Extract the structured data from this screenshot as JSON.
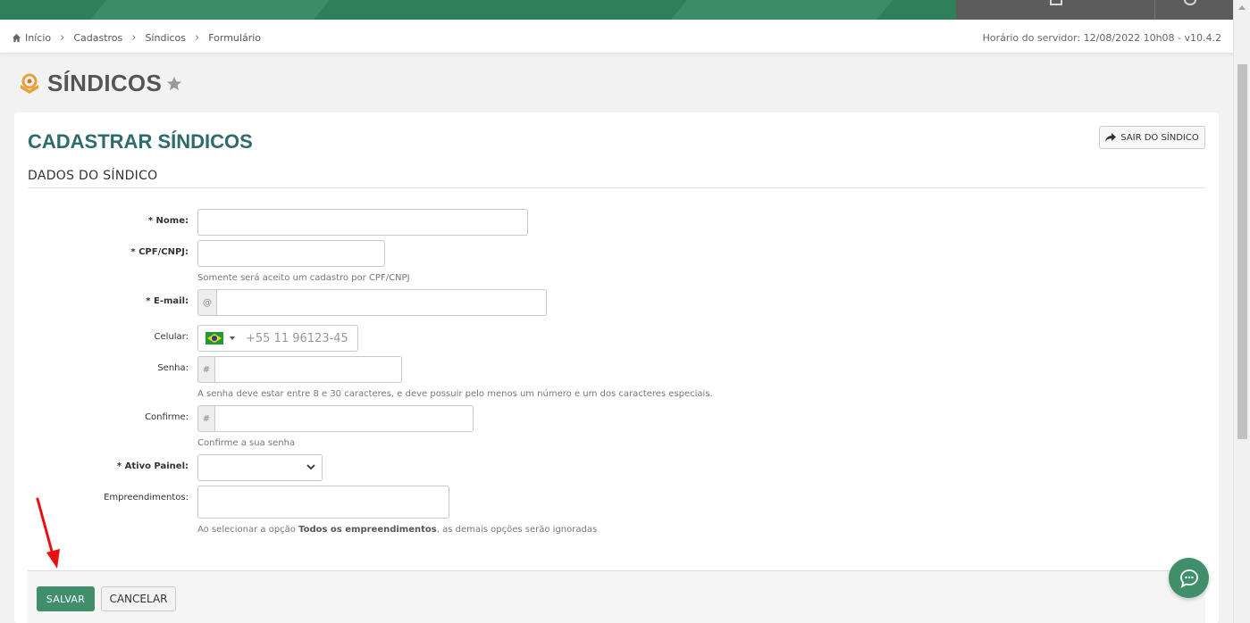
{
  "breadcrumb": {
    "items": [
      "Início",
      "Cadastros",
      "Síndicos",
      "Formulário"
    ]
  },
  "server_time": "Horário do servidor: 12/08/2022 10h08 - v10.4.2",
  "page": {
    "title": "SÍNDICOS"
  },
  "card": {
    "title": "CADASTRAR SÍNDICOS",
    "exit_label": "SAIR DO SÍNDICO",
    "section_title": "DADOS DO SÍNDICO"
  },
  "form": {
    "nome_label": "* Nome:",
    "cpf_label": "* CPF/CNPJ:",
    "cpf_help": "Somente será aceito um cadastro por CPF/CNPJ",
    "email_label": "* E-mail:",
    "email_addon": "@",
    "celular_label": "Celular:",
    "celular_placeholder": "+55 11 96123-45",
    "senha_label": "Senha:",
    "senha_addon": "#",
    "senha_help": "A senha deve estar entre 8 e 30 caracteres, e deve possuir pelo menos um número e um dos caracteres especiais.",
    "confirme_label": "Confirme:",
    "confirme_addon": "#",
    "confirme_help": "Confirme a sua senha",
    "ativo_label": "* Ativo Painel:",
    "ativo_value": "",
    "empreend_label": "Empreendimentos:",
    "empreend_help_pre": "Ao selecionar a opção ",
    "empreend_help_bold": "Todos os empreendimentos",
    "empreend_help_post": ", as demais opções serão ignoradas"
  },
  "actions": {
    "save_label": "SALVAR",
    "cancel_label": "CANCELAR"
  },
  "colors": {
    "brand_green": "#2f7f5b",
    "button_green": "#3f8f6b",
    "title_teal": "#2e6b6b",
    "annotation_red": "#e81010"
  },
  "icons": [
    "home-icon",
    "chevron-right-icon",
    "brand-icon",
    "star-icon",
    "share-icon",
    "flag-brazil-icon",
    "chevron-down-icon",
    "chat-icon"
  ]
}
